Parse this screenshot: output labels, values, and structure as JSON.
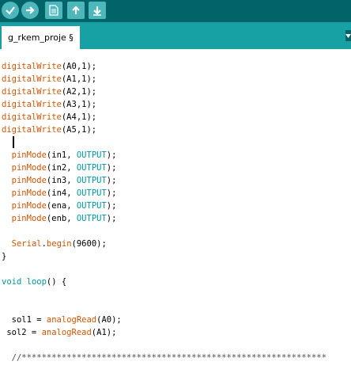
{
  "toolbar": {
    "buttons": [
      {
        "name": "verify",
        "icon": "check-icon"
      },
      {
        "name": "upload",
        "icon": "arrow-right-icon"
      },
      {
        "name": "new",
        "icon": "document-icon"
      },
      {
        "name": "open",
        "icon": "arrow-up-icon"
      },
      {
        "name": "save",
        "icon": "arrow-down-icon"
      }
    ],
    "background": "#006468"
  },
  "tab": {
    "label": "g_rkem_proje §"
  },
  "colors": {
    "function": "#d35400",
    "keyword": "#00979c",
    "tabbar": "#17a1a5"
  },
  "code": {
    "lines": [
      [
        {
          "t": "digitalWrite",
          "c": "fn"
        },
        {
          "t": "(A0,1);",
          "c": "plain"
        }
      ],
      [
        {
          "t": "digitalWrite",
          "c": "fn"
        },
        {
          "t": "(A1,1);",
          "c": "plain"
        }
      ],
      [
        {
          "t": "digitalWrite",
          "c": "fn"
        },
        {
          "t": "(A2,1);",
          "c": "plain"
        }
      ],
      [
        {
          "t": "digitalWrite",
          "c": "fn"
        },
        {
          "t": "(A3,1);",
          "c": "plain"
        }
      ],
      [
        {
          "t": "digitalWrite",
          "c": "fn"
        },
        {
          "t": "(A4,1);",
          "c": "plain"
        }
      ],
      [
        {
          "t": "digitalWrite",
          "c": "fn"
        },
        {
          "t": "(A5,1);",
          "c": "plain"
        }
      ],
      [],
      [
        {
          "t": "  ",
          "c": "plain"
        },
        {
          "t": "pinMode",
          "c": "fn"
        },
        {
          "t": "(in1, ",
          "c": "plain"
        },
        {
          "t": "OUTPUT",
          "c": "kw"
        },
        {
          "t": ");",
          "c": "plain"
        }
      ],
      [
        {
          "t": "  ",
          "c": "plain"
        },
        {
          "t": "pinMode",
          "c": "fn"
        },
        {
          "t": "(in2, ",
          "c": "plain"
        },
        {
          "t": "OUTPUT",
          "c": "kw"
        },
        {
          "t": ");",
          "c": "plain"
        }
      ],
      [
        {
          "t": "  ",
          "c": "plain"
        },
        {
          "t": "pinMode",
          "c": "fn"
        },
        {
          "t": "(in3, ",
          "c": "plain"
        },
        {
          "t": "OUTPUT",
          "c": "kw"
        },
        {
          "t": ");",
          "c": "plain"
        }
      ],
      [
        {
          "t": "  ",
          "c": "plain"
        },
        {
          "t": "pinMode",
          "c": "fn"
        },
        {
          "t": "(in4, ",
          "c": "plain"
        },
        {
          "t": "OUTPUT",
          "c": "kw"
        },
        {
          "t": ");",
          "c": "plain"
        }
      ],
      [
        {
          "t": "  ",
          "c": "plain"
        },
        {
          "t": "pinMode",
          "c": "fn"
        },
        {
          "t": "(ena, ",
          "c": "plain"
        },
        {
          "t": "OUTPUT",
          "c": "kw"
        },
        {
          "t": ");",
          "c": "plain"
        }
      ],
      [
        {
          "t": "  ",
          "c": "plain"
        },
        {
          "t": "pinMode",
          "c": "fn"
        },
        {
          "t": "(enb, ",
          "c": "plain"
        },
        {
          "t": "OUTPUT",
          "c": "kw"
        },
        {
          "t": ");",
          "c": "plain"
        }
      ],
      [],
      [
        {
          "t": "  ",
          "c": "plain"
        },
        {
          "t": "Serial",
          "c": "fn"
        },
        {
          "t": ".",
          "c": "plain"
        },
        {
          "t": "begin",
          "c": "fn"
        },
        {
          "t": "(9600);",
          "c": "plain"
        }
      ],
      [
        {
          "t": "}",
          "c": "plain"
        }
      ],
      [],
      [
        {
          "t": "void",
          "c": "kw"
        },
        {
          "t": " ",
          "c": "plain"
        },
        {
          "t": "loop",
          "c": "kw"
        },
        {
          "t": "() {",
          "c": "plain"
        }
      ],
      [],
      [],
      [
        {
          "t": "  sol1 = ",
          "c": "plain"
        },
        {
          "t": "analogRead",
          "c": "fn"
        },
        {
          "t": "(A0);",
          "c": "plain"
        }
      ],
      [
        {
          "t": " sol2 = ",
          "c": "plain"
        },
        {
          "t": "analogRead",
          "c": "fn"
        },
        {
          "t": "(A1);",
          "c": "plain"
        }
      ],
      [],
      [
        {
          "t": "  //*************************************************************",
          "c": "comment"
        }
      ]
    ]
  }
}
